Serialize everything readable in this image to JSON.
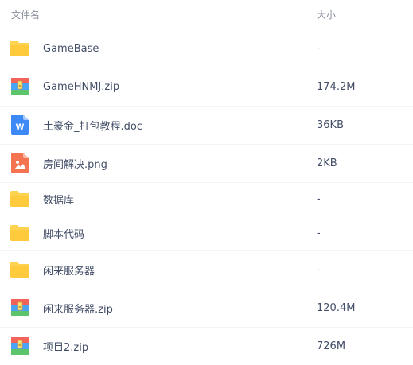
{
  "header": {
    "name_label": "文件名",
    "size_label": "大小"
  },
  "files": [
    {
      "name": "GameBase",
      "size": "-",
      "type": "folder-icon"
    },
    {
      "name": "GameHNMJ.zip",
      "size": "174.2M",
      "type": "zip-file-icon"
    },
    {
      "name": "土豪金_打包教程.doc",
      "size": "36KB",
      "type": "word-doc-icon"
    },
    {
      "name": "房间解决.png",
      "size": "2KB",
      "type": "image-file-icon"
    },
    {
      "name": "数据库",
      "size": "-",
      "type": "folder-icon"
    },
    {
      "name": "脚本代码",
      "size": "-",
      "type": "folder-icon"
    },
    {
      "name": "闲来服务器",
      "size": "-",
      "type": "folder-icon"
    },
    {
      "name": "闲来服务器.zip",
      "size": "120.4M",
      "type": "zip-file-icon"
    },
    {
      "name": "项目2.zip",
      "size": "726M",
      "type": "zip-file-icon"
    }
  ],
  "colors": {
    "folder": "#ffd34f",
    "word": "#3d8af7",
    "image": "#f47452",
    "text": "#424e67",
    "header_text": "#888e9a"
  }
}
